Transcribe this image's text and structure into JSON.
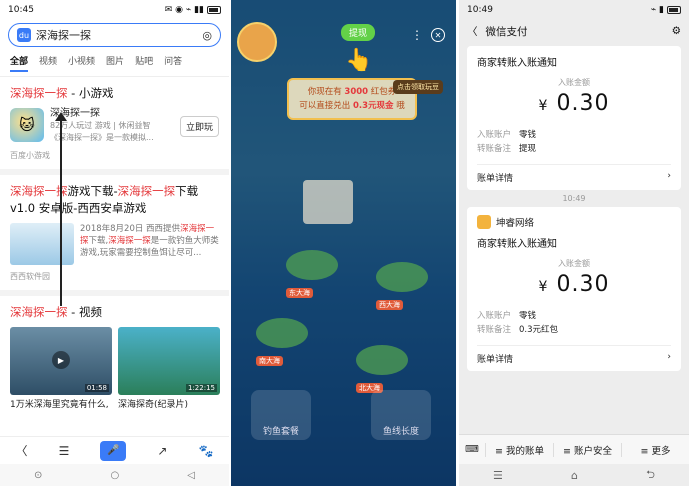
{
  "left": {
    "status": {
      "time": "10:45",
      "icons": "✉ ◉ ⌁ ▮▮"
    },
    "search": {
      "query": "深海探一探",
      "logo": "du",
      "camera": "◎"
    },
    "tabs": [
      "全部",
      "视频",
      "小视频",
      "图片",
      "贴吧",
      "问答"
    ],
    "card1": {
      "title_red": "深海探一探",
      "title_rest": " - 小游戏",
      "name": "深海探一探",
      "stats": "82万人玩过  游戏 | 休闲益智",
      "desc": "《深海探一探》是一款模拟...",
      "play": "立即玩",
      "source": "百度小游戏"
    },
    "card2": {
      "t1": "深海探一探",
      "t2": "游戏下载-",
      "t3": "深海探一探",
      "t4": "下载 v1.0 安卓版-西西安卓游戏",
      "date": "2018年8月20日 西西提供",
      "d_red": "深海探一探",
      "d_mid": "下载,",
      "d_red2": "深海探一探",
      "d_rest": "是一款钓鱼大师类游戏,玩家需要控制鱼饵让尽可...",
      "source": "西西软件园"
    },
    "card3": {
      "title_red": "深海探一探",
      "title_rest": " - 视频",
      "v1_dur": "01:58",
      "v2_dur": "1:22:15",
      "v1_cap": "1万米深海里究竟有什么,",
      "v2_cap": "深海探奇(纪录片)"
    },
    "nav": [
      "〈",
      "☰",
      "🎤",
      "↗",
      "🐾"
    ],
    "sys": [
      "⊙",
      "○",
      "◁"
    ]
  },
  "middle": {
    "tixian": "提现",
    "bubble_l1a": "你现在有 ",
    "bubble_l1b": "3000",
    "bubble_l1c": " 红包券",
    "bubble_l2a": "可以直接兑出 ",
    "bubble_l2b": "0.3元现金",
    "bubble_l2c": " 哦",
    "coin_btn": "点击领取玩豆",
    "labels": [
      "东大海",
      "西大海",
      "南大海",
      "北大海"
    ],
    "locks": [
      "钓鱼套餐",
      "鱼线长度"
    ]
  },
  "right": {
    "status": {
      "time": "10:49",
      "icons": "⌁ ▮"
    },
    "header_title": "微信支付",
    "card1": {
      "title": "商家转账入账通知",
      "sub": "入账金额",
      "yen": "¥",
      "amount": "0.30",
      "k1": "入账账户",
      "v1": "零钱",
      "k2": "转账备注",
      "v2": "提现",
      "detail": "账单详情"
    },
    "time_sep": "10:49",
    "card2": {
      "source": "坤睿网络",
      "title": "商家转账入账通知",
      "sub": "入账金额",
      "yen": "¥",
      "amount": "0.30",
      "k1": "入账账户",
      "v1": "零钱",
      "k2": "转账备注",
      "v2": "0.3元红包",
      "detail": "账单详情"
    },
    "bottom_menu": [
      "≡ 我的账单",
      "≡ 账户安全",
      "≡ 更多"
    ],
    "sys": [
      "☰",
      "⌂",
      "⮌"
    ]
  }
}
